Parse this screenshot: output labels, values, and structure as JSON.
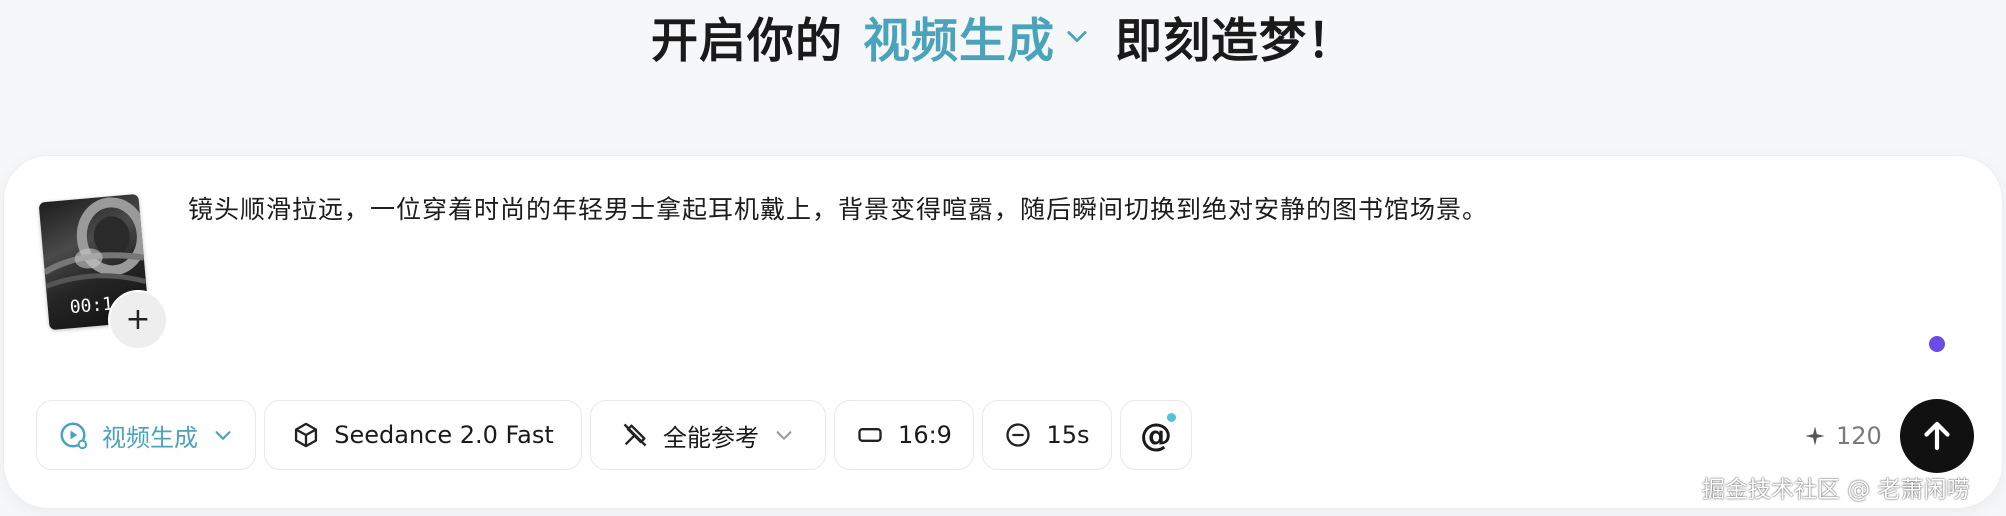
{
  "headline": {
    "prefix": "开启你的",
    "mode": "视频生成",
    "suffix": "即刻造梦！"
  },
  "prompt": {
    "text": "镜头顺滑拉远，一位穿着时尚的年轻男士拿起耳机戴上，背景变得喧嚣，随后瞬间切换到绝对安静的图书馆场景。"
  },
  "attachment": {
    "time_label": "00:1",
    "add_label": "+"
  },
  "toolbar": {
    "mode_label": "视频生成",
    "model_label": "Seedance 2.0 Fast",
    "reference_label": "全能参考",
    "ratio_label": "16:9",
    "duration_label": "15s",
    "mention_label": "@"
  },
  "credits": {
    "value": "120"
  },
  "watermark": "掘金技术社区 @ 老萧闲唠",
  "colors": {
    "accent": "#4aa3ba",
    "status_dot": "#6a4ce6",
    "mention_dot": "#4fc3d9",
    "send_button": "#111111"
  }
}
